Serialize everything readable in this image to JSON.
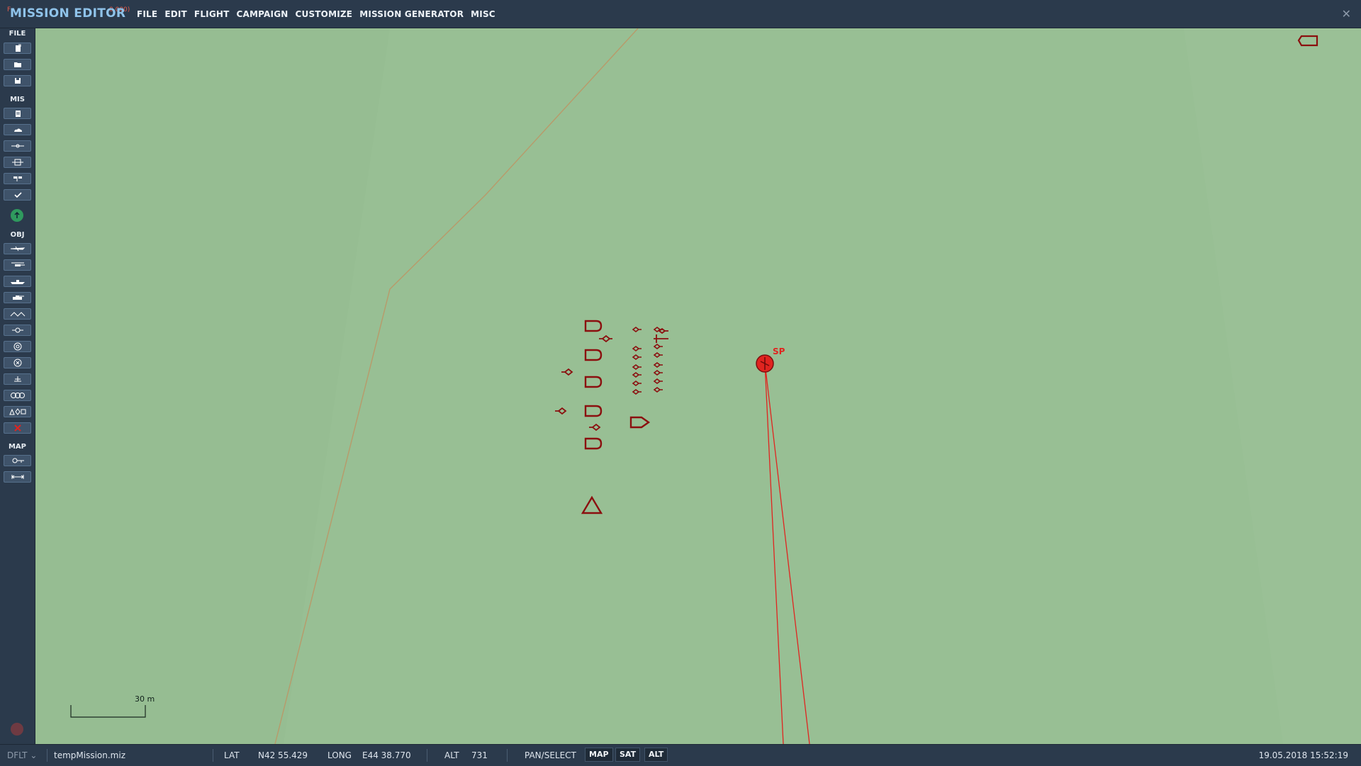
{
  "window": {
    "title": "MISSION EDITOR",
    "coords_left": "F",
    "coords_right": "0.000)"
  },
  "menu": [
    "FILE",
    "EDIT",
    "FLIGHT",
    "CAMPAIGN",
    "CUSTOMIZE",
    "MISSION GENERATOR",
    "MISC"
  ],
  "toolbar": {
    "sections": {
      "file": "FILE",
      "mis": "MIS",
      "obj": "OBJ",
      "map": "MAP"
    },
    "file_buttons": [
      "new-mission-icon",
      "open-mission-icon",
      "save-mission-icon"
    ],
    "mis_buttons": [
      "briefing-icon",
      "weather-icon",
      "triggered-actions-icon",
      "resources-icon",
      "goals-icon",
      "checklist-icon"
    ],
    "obj_buttons": [
      "airplane-icon",
      "helicopter-icon",
      "ship-icon",
      "vehicle-icon",
      "static-object-icon",
      "trigger-zone-icon",
      "target-icon",
      "navigation-point-icon",
      "template-icon",
      "unit-group-icon",
      "shapes-icon",
      "delete-icon"
    ],
    "map_buttons": [
      "map-options-icon",
      "ruler-icon"
    ]
  },
  "map": {
    "scale_label": "30 m",
    "sp_label": "SP"
  },
  "status": {
    "profile": "DFLT",
    "filename": "tempMission.miz",
    "lat_label": "LAT",
    "lat_value": "N42 55.429",
    "long_label": "LONG",
    "long_value": "E44 38.770",
    "alt_label": "ALT",
    "alt_value": "731",
    "mode": "PAN/SELECT",
    "map_btn": "MAP",
    "sat_btn": "SAT",
    "alt_btn": "ALT",
    "datetime": "19.05.2018 15:52:19"
  },
  "colors": {
    "map_bg": "#98bf94",
    "unit_red": "#8b0f0f",
    "route_red": "#e0241f",
    "road": "#b89a6a",
    "panel": "#2b3a4c"
  }
}
